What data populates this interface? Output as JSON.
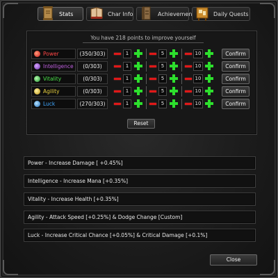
{
  "tabs": [
    {
      "label": "Stats",
      "icon": "scroll-icon"
    },
    {
      "label": "Char Info",
      "icon": "book-icon"
    },
    {
      "label": "Achievement",
      "icon": "scroll-icon"
    },
    {
      "label": "Daily Quests",
      "icon": "quest-board-icon"
    }
  ],
  "points_text": "You have 218 points to improve yourself",
  "stats": [
    {
      "name": "Power",
      "value": "(350/303)",
      "color": "#ff4646",
      "icon": "power-icon"
    },
    {
      "name": "Intelligence",
      "value": "(0/303)",
      "color": "#c060e0",
      "icon": "intelligence-icon"
    },
    {
      "name": "Vitality",
      "value": "(0/303)",
      "color": "#4ae04a",
      "icon": "vitality-icon"
    },
    {
      "name": "Agility",
      "value": "(0/303)",
      "color": "#e8d040",
      "icon": "agility-icon"
    },
    {
      "name": "Luck",
      "value": "(270/303)",
      "color": "#40a8ff",
      "icon": "luck-icon"
    }
  ],
  "increments": [
    "1",
    "5",
    "10"
  ],
  "confirm_label": "Confirm",
  "reset_label": "Reset",
  "info": [
    "Power - Increase Damage [ +0.45%]",
    "Intelligence - Increase Mana [+0.35%]",
    "Vitality - Increase Health [+0.35%]",
    "Agility - Attack Speed [+0.25%] & Dodge Change [Custom]",
    "Luck - Increase Critical Chance [+0.05%] & Critical Damage [+0.1%]"
  ],
  "close_label": "Close"
}
